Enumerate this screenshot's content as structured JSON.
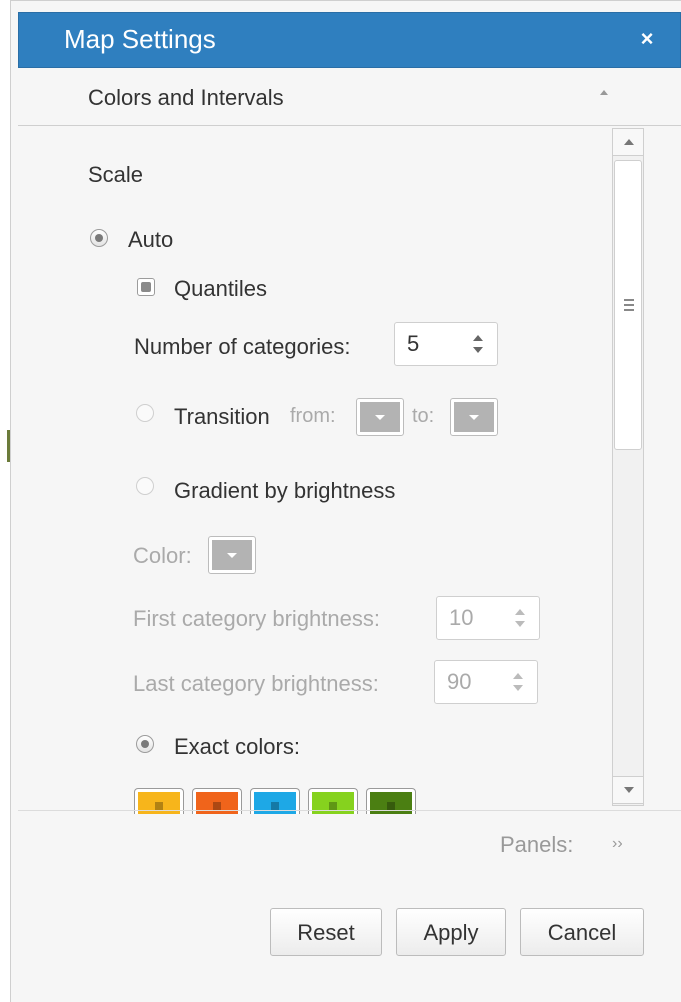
{
  "dialog": {
    "title": "Map Settings",
    "close_icon": "×",
    "section_title": "Colors and Intervals"
  },
  "scale": {
    "heading": "Scale",
    "auto_label": "Auto",
    "quantiles_label": "Quantiles",
    "num_categories_label": "Number of categories:",
    "num_categories_value": "5",
    "transition_label": "Transition",
    "transition_from_label": "from:",
    "transition_to_label": "to:",
    "gradient_label": "Gradient by brightness",
    "color_label": "Color:",
    "first_brightness_label": "First category brightness:",
    "first_brightness_value": "10",
    "last_brightness_label": "Last category brightness:",
    "last_brightness_value": "90",
    "exact_colors_label": "Exact colors:",
    "exact_colors": [
      "#f7b51b",
      "#f0641b",
      "#1ea8e6",
      "#86d21e",
      "#4b7f12"
    ]
  },
  "footer": {
    "panels_label": "Panels:",
    "panels_icon": "››",
    "reset_label": "Reset",
    "apply_label": "Apply",
    "cancel_label": "Cancel"
  },
  "colors": {
    "titlebar": "#2f7fbf",
    "disabled_swatch": "#b3b3b3"
  }
}
